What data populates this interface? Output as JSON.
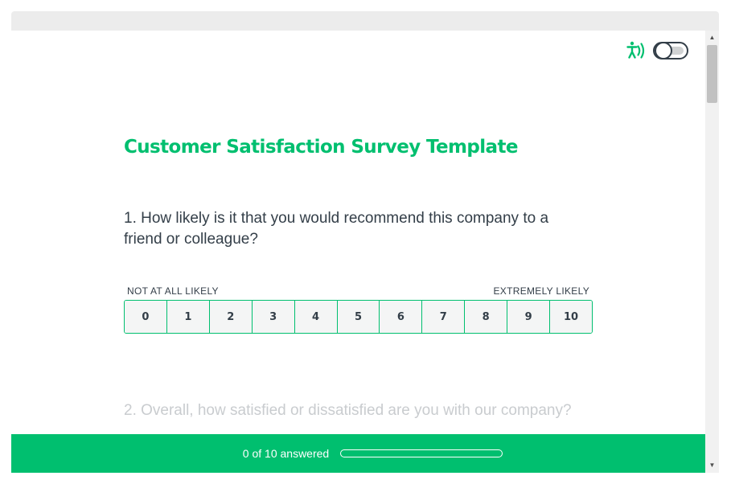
{
  "survey": {
    "title": "Customer Satisfaction Survey Template"
  },
  "accessibility": {
    "icon": "accessibility-audio-icon",
    "toggle_on": false
  },
  "questions": [
    {
      "number": 1,
      "text": "1. How likely is it that you would recommend this company to a friend or colleague?",
      "scale": {
        "low_label": "NOT AT ALL LIKELY",
        "high_label": "EXTREMELY LIKELY",
        "options": [
          "0",
          "1",
          "2",
          "3",
          "4",
          "5",
          "6",
          "7",
          "8",
          "9",
          "10"
        ]
      }
    },
    {
      "number": 2,
      "text": "2. Overall, how satisfied or dissatisfied are you with our company?"
    }
  ],
  "progress": {
    "label": "0 of 10 answered",
    "answered": 0,
    "total": 10,
    "fraction": 0
  },
  "colors": {
    "brand": "#00bf6f",
    "text": "#333e48",
    "faded_text": "#c9cccf"
  }
}
